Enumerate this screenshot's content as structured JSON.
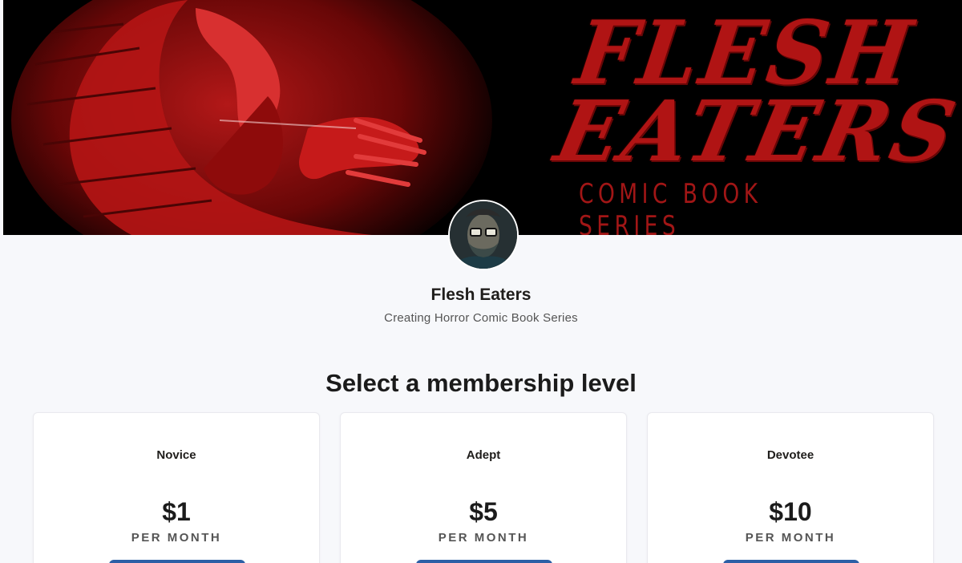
{
  "banner": {
    "logo_line1": "FLESH",
    "logo_line2": "EATERS",
    "logo_line3": "COMIC BOOK SERIES",
    "colors": {
      "background": "#000000",
      "art_red": "#c01818"
    }
  },
  "creator": {
    "name": "Flesh Eaters",
    "tagline": "Creating Horror Comic Book Series"
  },
  "membership": {
    "title": "Select a membership level",
    "tiers": [
      {
        "name": "Novice",
        "price": "$1",
        "period": "PER MONTH"
      },
      {
        "name": "Adept",
        "price": "$5",
        "period": "PER MONTH"
      },
      {
        "name": "Devotee",
        "price": "$10",
        "period": "PER MONTH"
      }
    ]
  },
  "colors": {
    "page_background": "#f7f8fb",
    "card_background": "#ffffff",
    "button": "#2c5fa6"
  }
}
